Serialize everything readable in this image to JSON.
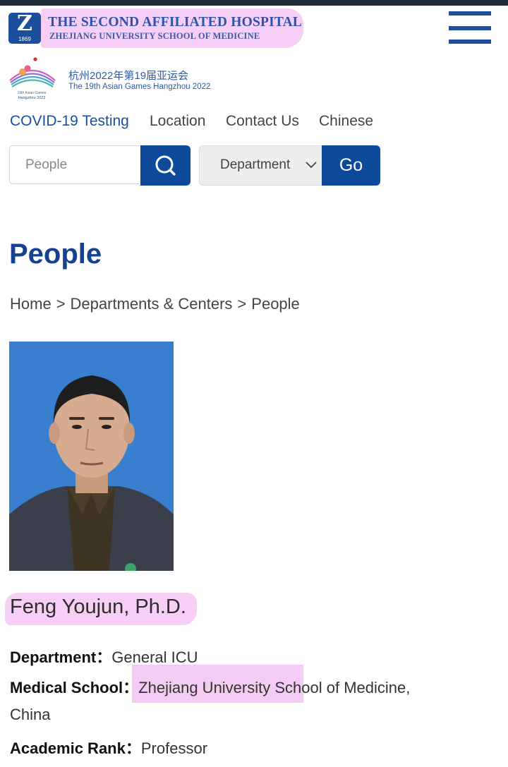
{
  "header": {
    "logo_letter": "Z",
    "logo_year": "1869",
    "hospital_name": "THE SECOND AFFILIATED HOSPITAL",
    "school_name": "ZHEJIANG UNIVERSITY SCHOOL OF MEDICINE",
    "menu_icon": "hamburger-icon"
  },
  "asian_games": {
    "logo_caption_1": "19th Asian Games",
    "logo_caption_2": "Hangzhou 2022",
    "title_cn": "杭州2022年第19届亚运会",
    "title_en": "The 19th Asian Games Hangzhou 2022"
  },
  "nav": {
    "items": [
      {
        "label": "COVID-19 Testing"
      },
      {
        "label": "Location"
      },
      {
        "label": "Contact Us"
      },
      {
        "label": "Chinese"
      }
    ]
  },
  "search": {
    "placeholder": "People",
    "value": "",
    "search_icon": "search-icon",
    "department_select": "Department",
    "go_label": "Go"
  },
  "page": {
    "title": "People"
  },
  "breadcrumb": {
    "items": [
      "Home",
      "Departments & Centers",
      "People"
    ],
    "separator": ">"
  },
  "person": {
    "name": "Feng Youjun, Ph.D.",
    "department_label": "Department",
    "department": "General ICU",
    "school_label": "Medical School",
    "school_highlight": "Zhejiang University",
    "school_rest": "School of Medicine,",
    "school_line2": "China",
    "rank_label": "Academic Rank",
    "rank": "Professor",
    "colon": "："
  },
  "colors": {
    "brand_blue": "#0d4a9c",
    "title_blue": "#17418f",
    "highlight_pink": "#f4c6f4",
    "photo_background": "#3a7fcf"
  }
}
